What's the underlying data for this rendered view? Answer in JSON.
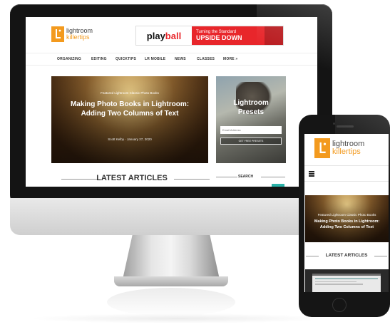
{
  "desktop": {
    "logo": {
      "line1": "lightroom",
      "line2": "killertips"
    },
    "ad": {
      "brand_a": "play",
      "brand_b": "ball",
      "line1": "Turning the Standard",
      "line2": "UPSIDE DOWN"
    },
    "nav": [
      "ORGANIZING",
      "EDITING",
      "QUICKTIPS",
      "LR MOBILE",
      "NEWS",
      "CLASSES",
      "MORE »"
    ],
    "hero": {
      "tags": "Featured  Lightroom Classic  Photo Books",
      "title_line1": "Making Photo Books in Lightroom:",
      "title_line2": "Adding Two Columns of Text",
      "meta": "Scott Kelby · January 27, 2020"
    },
    "side": {
      "title_line1": "Lightroom",
      "title_line2": "Presets",
      "email_placeholder": "Email Address",
      "button": "GET FREE PRESETS"
    },
    "latest_articles": "LATEST ARTICLES",
    "search": "SEARCH"
  },
  "mobile": {
    "logo": {
      "line1": "lightroom",
      "line2": "killertips"
    },
    "menu_icon": "hamburger-icon",
    "hero": {
      "tags": "Featured  Lightroom Classic  Photo Books",
      "title_line1": "Making Photo Books in Lightroom:",
      "title_line2": "Adding Two Columns of Text"
    },
    "latest_articles": "LATEST ARTICLES"
  },
  "colors": {
    "brand_orange": "#f39a1e",
    "ad_red": "#e8262b",
    "device_black": "#141414"
  }
}
